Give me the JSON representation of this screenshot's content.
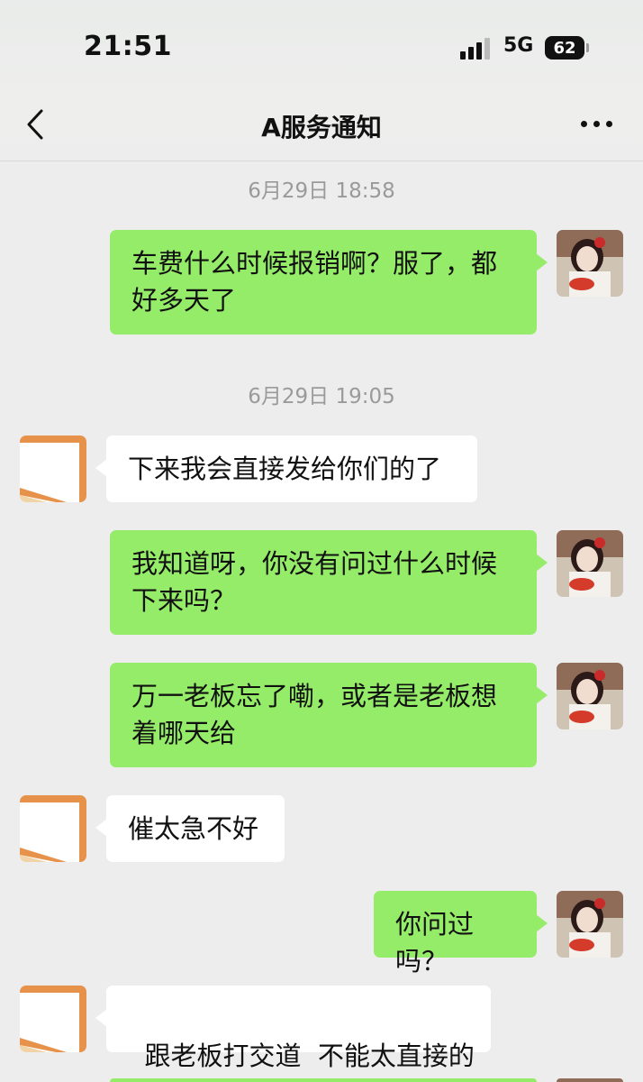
{
  "status_bar": {
    "time": "21:51",
    "network": "5G",
    "battery": "62"
  },
  "header": {
    "title": "A服务通知",
    "back_icon": "chevron-left-icon",
    "more_icon": "more-dots-icon"
  },
  "timestamps": [
    "6月29日 18:58",
    "6月29日 19:05"
  ],
  "messages": [
    {
      "from": "me",
      "text": "车费什么时候报销啊？服了，都好多天了"
    },
    {
      "from": "other",
      "text": "下来我会直接发给你们的了"
    },
    {
      "from": "me",
      "text": "我知道呀，你没有问过什么时候下来吗？"
    },
    {
      "from": "me",
      "text": "万一老板忘了嘞，或者是老板想着哪天给"
    },
    {
      "from": "other",
      "text": "催太急不好"
    },
    {
      "from": "me",
      "text": "你问过吗？"
    },
    {
      "from": "other",
      "text": "跟老板打交道  不能太直接的"
    }
  ],
  "colors": {
    "my_bubble": "#95ec69",
    "other_bubble": "#ffffff",
    "background": "#ededed",
    "timestamp": "#9a9a9a"
  }
}
